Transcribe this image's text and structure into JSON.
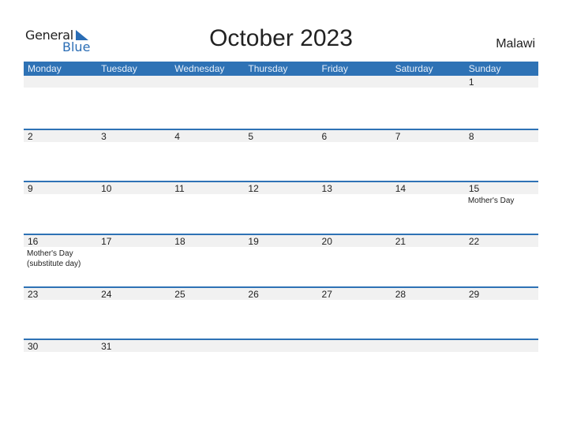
{
  "logo": {
    "general": "General",
    "blue": "Blue"
  },
  "title": "October 2023",
  "country": "Malawi",
  "colors": {
    "accent": "#2e72b5",
    "strip": "#f1f1f1"
  },
  "weekdays": [
    "Monday",
    "Tuesday",
    "Wednesday",
    "Thursday",
    "Friday",
    "Saturday",
    "Sunday"
  ],
  "weeks": [
    [
      {
        "d": ""
      },
      {
        "d": ""
      },
      {
        "d": ""
      },
      {
        "d": ""
      },
      {
        "d": ""
      },
      {
        "d": ""
      },
      {
        "d": "1"
      }
    ],
    [
      {
        "d": "2"
      },
      {
        "d": "3"
      },
      {
        "d": "4"
      },
      {
        "d": "5"
      },
      {
        "d": "6"
      },
      {
        "d": "7"
      },
      {
        "d": "8"
      }
    ],
    [
      {
        "d": "9"
      },
      {
        "d": "10"
      },
      {
        "d": "11"
      },
      {
        "d": "12"
      },
      {
        "d": "13"
      },
      {
        "d": "14"
      },
      {
        "d": "15",
        "e": "Mother's Day"
      }
    ],
    [
      {
        "d": "16",
        "e": "Mother's Day\n(substitute day)"
      },
      {
        "d": "17"
      },
      {
        "d": "18"
      },
      {
        "d": "19"
      },
      {
        "d": "20"
      },
      {
        "d": "21"
      },
      {
        "d": "22"
      }
    ],
    [
      {
        "d": "23"
      },
      {
        "d": "24"
      },
      {
        "d": "25"
      },
      {
        "d": "26"
      },
      {
        "d": "27"
      },
      {
        "d": "28"
      },
      {
        "d": "29"
      }
    ],
    [
      {
        "d": "30"
      },
      {
        "d": "31"
      },
      {
        "d": ""
      },
      {
        "d": ""
      },
      {
        "d": ""
      },
      {
        "d": ""
      },
      {
        "d": ""
      }
    ]
  ]
}
